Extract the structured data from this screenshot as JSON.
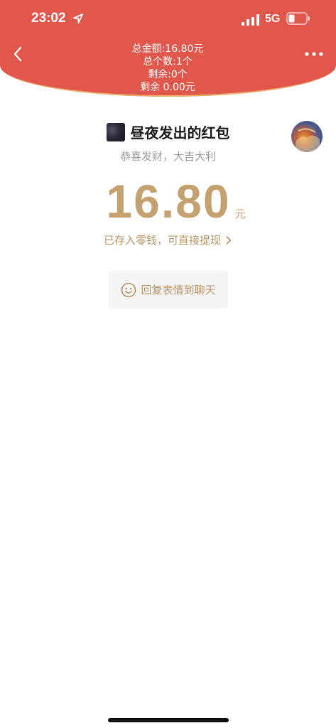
{
  "status_bar": {
    "time": "23:02",
    "network": "5G",
    "icons": [
      "location-arrow-icon",
      "signal-icon",
      "battery-icon"
    ]
  },
  "header": {
    "total_amount": "总金额:16.80元",
    "total_count": "总个数:1个",
    "remaining_count": "剩余:0个",
    "remaining_amount": "剩余 0.00元",
    "back_icon": "chevron-left-icon",
    "more_icon": "more-dots-icon"
  },
  "packet": {
    "sender_title": "昼夜发出的红包",
    "greeting": "恭喜发财，大吉大利",
    "amount": "16.80",
    "unit": "元",
    "stored_note": "已存入零钱，可直接提现",
    "reply_label": "回复表情到聊天",
    "reply_icon": "smiley-icon"
  },
  "colors": {
    "header_red": "#E2574C",
    "gold_text": "#C4A16F",
    "gold_line": "#E8B06A"
  }
}
